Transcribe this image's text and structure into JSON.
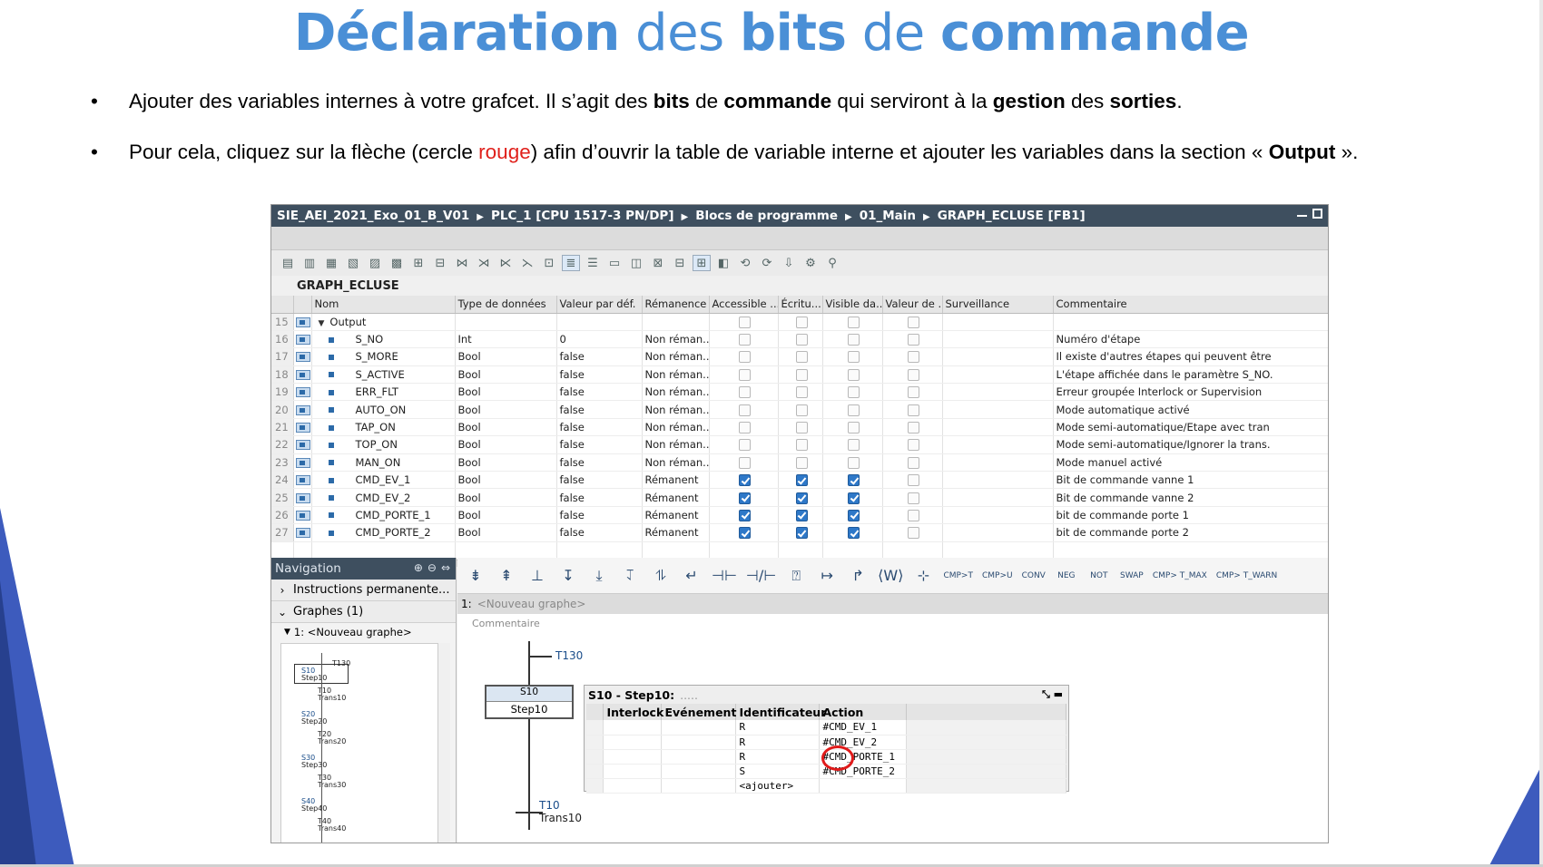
{
  "slide": {
    "title_parts": [
      {
        "text": "Déclaration",
        "bold": true
      },
      {
        "text": " des ",
        "bold": false
      },
      {
        "text": "bits",
        "bold": true
      },
      {
        "text": " de ",
        "bold": false
      },
      {
        "text": "commande",
        "bold": true
      }
    ],
    "bullet1": [
      {
        "text": "Ajouter des variables internes à votre grafcet. Il s’agit des ",
        "style": "n"
      },
      {
        "text": "bits",
        "style": "b"
      },
      {
        "text": " de ",
        "style": "n"
      },
      {
        "text": "commande",
        "style": "b"
      },
      {
        "text": " qui serviront à la ",
        "style": "n"
      },
      {
        "text": "gestion",
        "style": "b"
      },
      {
        "text": " des ",
        "style": "n"
      },
      {
        "text": "sorties",
        "style": "b"
      },
      {
        "text": ".",
        "style": "n"
      }
    ],
    "bullet2": [
      {
        "text": "Pour cela, cliquez sur la flèche (cercle ",
        "style": "n"
      },
      {
        "text": "rouge",
        "style": "r"
      },
      {
        "text": ") afin d’ouvrir la table de variable interne et ajouter les variables dans la section « ",
        "style": "n"
      },
      {
        "text": "Output",
        "style": "b"
      },
      {
        "text": " ».",
        "style": "n"
      }
    ],
    "bullet_glyph": "•"
  },
  "window": {
    "breadcrumb": [
      "SIE_AEI_2021_Exo_01_B_V01",
      "PLC_1 [CPU 1517-3 PN/DP]",
      "Blocs de programme",
      "01_Main",
      "GRAPH_ECLUSE [FB1]"
    ],
    "block_title": "GRAPH_ECLUSE",
    "columns": [
      "",
      "",
      "Nom",
      "Type de données",
      "Valeur par déf.",
      "Rémanence",
      "Accessible ...",
      "Écritu...",
      "Visible da...",
      "Valeur de ...",
      "Surveillance",
      "Commentaire"
    ],
    "section_row": {
      "num": "15",
      "name": "Output"
    },
    "rows": [
      {
        "num": "16",
        "name": "S_NO",
        "type": "Int",
        "default": "0",
        "retain": "Non réman...",
        "checks": false,
        "comment": "Numéro d'étape"
      },
      {
        "num": "17",
        "name": "S_MORE",
        "type": "Bool",
        "default": "false",
        "retain": "Non réman...",
        "checks": false,
        "comment": "Il existe d'autres étapes qui peuvent être"
      },
      {
        "num": "18",
        "name": "S_ACTIVE",
        "type": "Bool",
        "default": "false",
        "retain": "Non réman...",
        "checks": false,
        "comment": "L'étape affichée dans le paramètre S_NO."
      },
      {
        "num": "19",
        "name": "ERR_FLT",
        "type": "Bool",
        "default": "false",
        "retain": "Non réman...",
        "checks": false,
        "comment": "Erreur groupée Interlock or Supervision"
      },
      {
        "num": "20",
        "name": "AUTO_ON",
        "type": "Bool",
        "default": "false",
        "retain": "Non réman...",
        "checks": false,
        "comment": "Mode automatique activé"
      },
      {
        "num": "21",
        "name": "TAP_ON",
        "type": "Bool",
        "default": "false",
        "retain": "Non réman...",
        "checks": false,
        "comment": "Mode semi-automatique/Etape avec tran"
      },
      {
        "num": "22",
        "name": "TOP_ON",
        "type": "Bool",
        "default": "false",
        "retain": "Non réman...",
        "checks": false,
        "comment": "Mode semi-automatique/Ignorer la trans."
      },
      {
        "num": "23",
        "name": "MAN_ON",
        "type": "Bool",
        "default": "false",
        "retain": "Non réman...",
        "checks": false,
        "comment": "Mode manuel activé"
      },
      {
        "num": "24",
        "name": "CMD_EV_1",
        "type": "Bool",
        "default": "false",
        "retain": "Rémanent",
        "checks": true,
        "comment": "Bit de commande vanne 1"
      },
      {
        "num": "25",
        "name": "CMD_EV_2",
        "type": "Bool",
        "default": "false",
        "retain": "Rémanent",
        "checks": true,
        "comment": "Bit de commande vanne 2"
      },
      {
        "num": "26",
        "name": "CMD_PORTE_1",
        "type": "Bool",
        "default": "false",
        "retain": "Rémanent",
        "checks": true,
        "comment": "bit de commande porte 1"
      },
      {
        "num": "27",
        "name": "CMD_PORTE_2",
        "type": "Bool",
        "default": "false",
        "retain": "Rémanent",
        "checks": true,
        "comment": "bit de commande porte 2"
      }
    ],
    "navigation": {
      "title": "Navigation",
      "item1": "Instructions permanente...",
      "item2": "Graphes (1)",
      "sub": "1: <Nouveau graphe>",
      "tree": [
        {
          "label": "T130"
        },
        {
          "label": "S10"
        },
        {
          "label": "Step10"
        },
        {
          "label": "T10"
        },
        {
          "label": "Trans10"
        },
        {
          "label": "S20"
        },
        {
          "label": "Step20"
        },
        {
          "label": "T20"
        },
        {
          "label": "Trans20"
        },
        {
          "label": "S30"
        },
        {
          "label": "Step30"
        },
        {
          "label": "T30"
        },
        {
          "label": "Trans30"
        },
        {
          "label": "S40"
        },
        {
          "label": "Step40"
        },
        {
          "label": "T40"
        },
        {
          "label": "Trans40"
        }
      ]
    },
    "graph_toolbar_small": [
      "CMP>T",
      "CMP>U",
      "CONV",
      "NEG",
      "NOT",
      "SWAP",
      "CMP> T_MAX",
      "CMP> T_WARN"
    ],
    "graph": {
      "num": "1:",
      "name": "<Nouveau graphe>",
      "comment": "Commentaire",
      "trans_top": "T130",
      "step_id": "S10",
      "step_name": "Step10",
      "trans_bot_id": "T10",
      "trans_bot_name": "Trans10"
    },
    "action": {
      "title": "S10 - Step10:",
      "title_dots": ".....",
      "headers": [
        "Interlock",
        "Evénement",
        "Identificateur",
        "Action"
      ],
      "rows": [
        {
          "id": "R",
          "action": "#CMD_EV_1"
        },
        {
          "id": "R",
          "action": "#CMD_EV_2"
        },
        {
          "id": "R",
          "action": "#CMD_PORTE_1"
        },
        {
          "id": "S",
          "action": "#CMD_PORTE_2"
        },
        {
          "id": "<ajouter>",
          "action": ""
        }
      ]
    }
  }
}
